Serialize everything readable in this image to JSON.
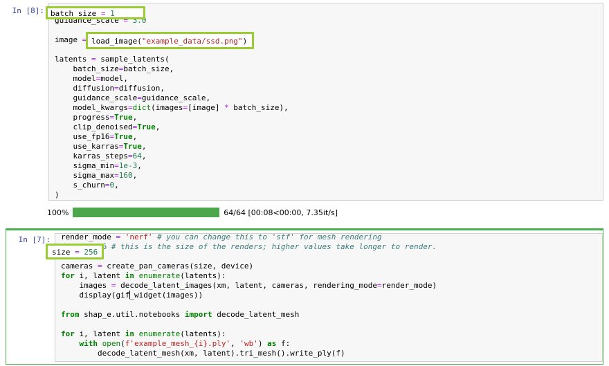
{
  "app": {
    "name": "Jupyter Notebook",
    "background": "#ffffff"
  },
  "colors": {
    "prompt": "#303f9f",
    "cell_background": "#f7f7f7",
    "cell_border": "#cfcfcf",
    "selection_green": "#4caf50",
    "annotation_green": "#9acd32",
    "progress_green": "#4ca64c",
    "keyword": "#008000",
    "string": "#ba2121",
    "comment": "#3d7b7b",
    "number": "#208050",
    "operator": "#aa22ff"
  },
  "cells": [
    {
      "prompt": "In [8]:",
      "lines": [
        "batch_size = 1",
        "guidance_scale = 3.0",
        "",
        "image = load_image(\"example_data/ssd.png\")",
        "",
        "latents = sample_latents(",
        "    batch_size=batch_size,",
        "    model=model,",
        "    diffusion=diffusion,",
        "    guidance_scale=guidance_scale,",
        "    model_kwargs=dict(images=[image] * batch_size),",
        "    progress=True,",
        "    clip_denoised=True,",
        "    use_fp16=True,",
        "    use_karras=True,",
        "    karras_steps=64,",
        "    sigma_min=1e-3,",
        "    sigma_max=160,",
        "    s_churn=0,",
        ")"
      ],
      "output": {
        "type": "progress_bar",
        "percent_label": "100%",
        "percent_value": 100,
        "meta_label": "64/64 [00:08<00:00, 7.35it/s]"
      }
    },
    {
      "prompt": "In [7]:",
      "selected": true,
      "lines": [
        "render_mode = 'nerf' # you can change this to 'stf' for mesh rendering",
        "size = 256 # this is the size of the renders; higher values take longer to render.",
        "",
        "cameras = create_pan_cameras(size, device)",
        "for i, latent in enumerate(latents):",
        "    images = decode_latent_images(xm, latent, cameras, rendering_mode=render_mode)",
        "    display(gif_widget(images))",
        "",
        "from shap_e.util.notebooks import decode_latent_mesh",
        "",
        "for i, latent in enumerate(latents):",
        "    with open(f'example_mesh_{i}.ply', 'wb') as f:",
        "        decode_latent_mesh(xm, latent).tri_mesh().write_ply(f)"
      ]
    }
  ],
  "annotations": [
    {
      "name": "batch-size-highlight",
      "text": "batch_size = 1"
    },
    {
      "name": "load-image-highlight",
      "text": "load_image(\"example_data/ssd.png\")"
    },
    {
      "name": "size-highlight",
      "text": "size = 256"
    }
  ]
}
